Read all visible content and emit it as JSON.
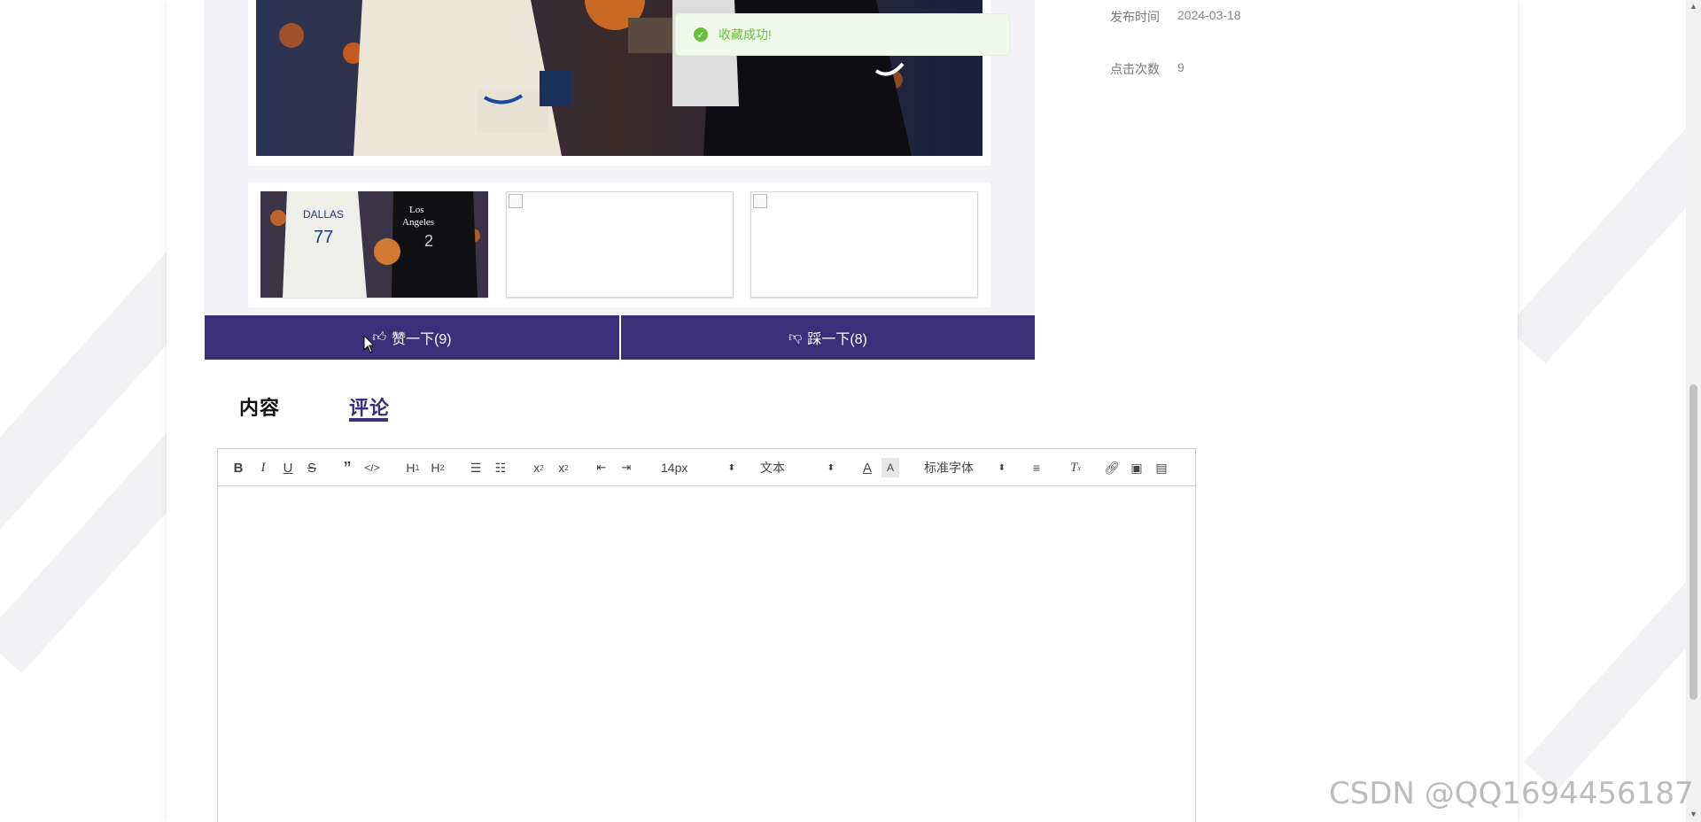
{
  "meta": {
    "publish_time_label": "发布时间",
    "publish_time_value": "2024-03-18",
    "click_count_label": "点击次数",
    "click_count_value": "9"
  },
  "toast": {
    "message": "收藏成功!"
  },
  "votes": {
    "like_label": "赞一下(9)",
    "dislike_label": "踩一下(8)"
  },
  "tabs": [
    {
      "label": "内容",
      "active": false
    },
    {
      "label": "评论",
      "active": true
    }
  ],
  "editor": {
    "font_size_value": "14px",
    "header_value": "文本",
    "font_family_value": "标准字体",
    "buttons": [
      "bold",
      "italic",
      "underline",
      "strike",
      "blockquote",
      "code-block",
      "h1",
      "h2",
      "ordered-list",
      "bullet-list",
      "subscript",
      "superscript",
      "outdent",
      "indent",
      "font-color",
      "background-color",
      "align",
      "clean",
      "link",
      "image",
      "video"
    ]
  },
  "thumbnails": [
    {
      "name": "players-photo"
    },
    {
      "name": "broken-image"
    },
    {
      "name": "broken-image"
    }
  ],
  "watermark": "CSDN @QQ1694456187",
  "colors": {
    "accent": "#3c2f7a",
    "success": "#67c23a",
    "success_bg": "#f0f9eb"
  }
}
